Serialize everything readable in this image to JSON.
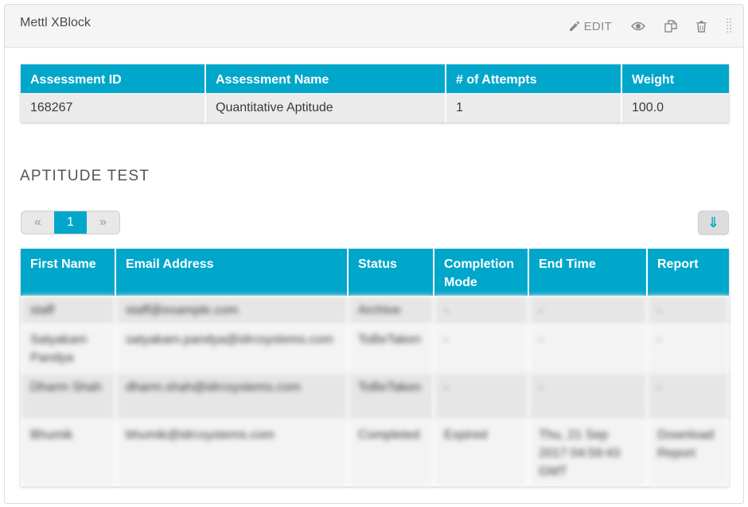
{
  "xblock": {
    "title": "Mettl XBlock",
    "actions": {
      "edit_label": "EDIT",
      "edit_icon": "pencil-icon",
      "preview_icon": "eye-icon",
      "duplicate_icon": "duplicate-icon",
      "delete_icon": "trash-icon",
      "drag_icon": "drag-handle-icon"
    }
  },
  "assessment_table": {
    "headers": [
      "Assessment ID",
      "Assessment Name",
      "# of Attempts",
      "Weight"
    ],
    "rows": [
      [
        "168267",
        "Quantitative Aptitude",
        "1",
        "100.0"
      ]
    ]
  },
  "section": {
    "title": "APTITUDE TEST"
  },
  "pagination": {
    "prev": "«",
    "current": "1",
    "next": "»"
  },
  "download_all": {
    "icon": "download-arrow-icon",
    "glyph": "⇓"
  },
  "results_table": {
    "headers": [
      "First Name",
      "Email Address",
      "Status",
      "Completion Mode",
      "End Time",
      "Report"
    ],
    "rows": [
      [
        "staff",
        "staff@example.com",
        "Archive",
        "-",
        "-",
        "-"
      ],
      [
        "Satyakam Pandya",
        "satyakam.pandya@idrcsystems.com",
        "ToBeTaken",
        "-",
        "-",
        "-"
      ],
      [
        "Dharm Shah",
        "dharm.shah@idrcsystems.com",
        "ToBeTaken",
        "-",
        "-",
        "-"
      ],
      [
        "Bhumik",
        "bhumik@idrcsystems.com",
        "Completed",
        "Expired",
        "Thu, 21 Sep 2017 04:59:43 GMT",
        "Download Report"
      ]
    ]
  },
  "colors": {
    "accent": "#00a7cb",
    "link": "#1ea4d8",
    "header_bg": "#f5f5f5"
  }
}
